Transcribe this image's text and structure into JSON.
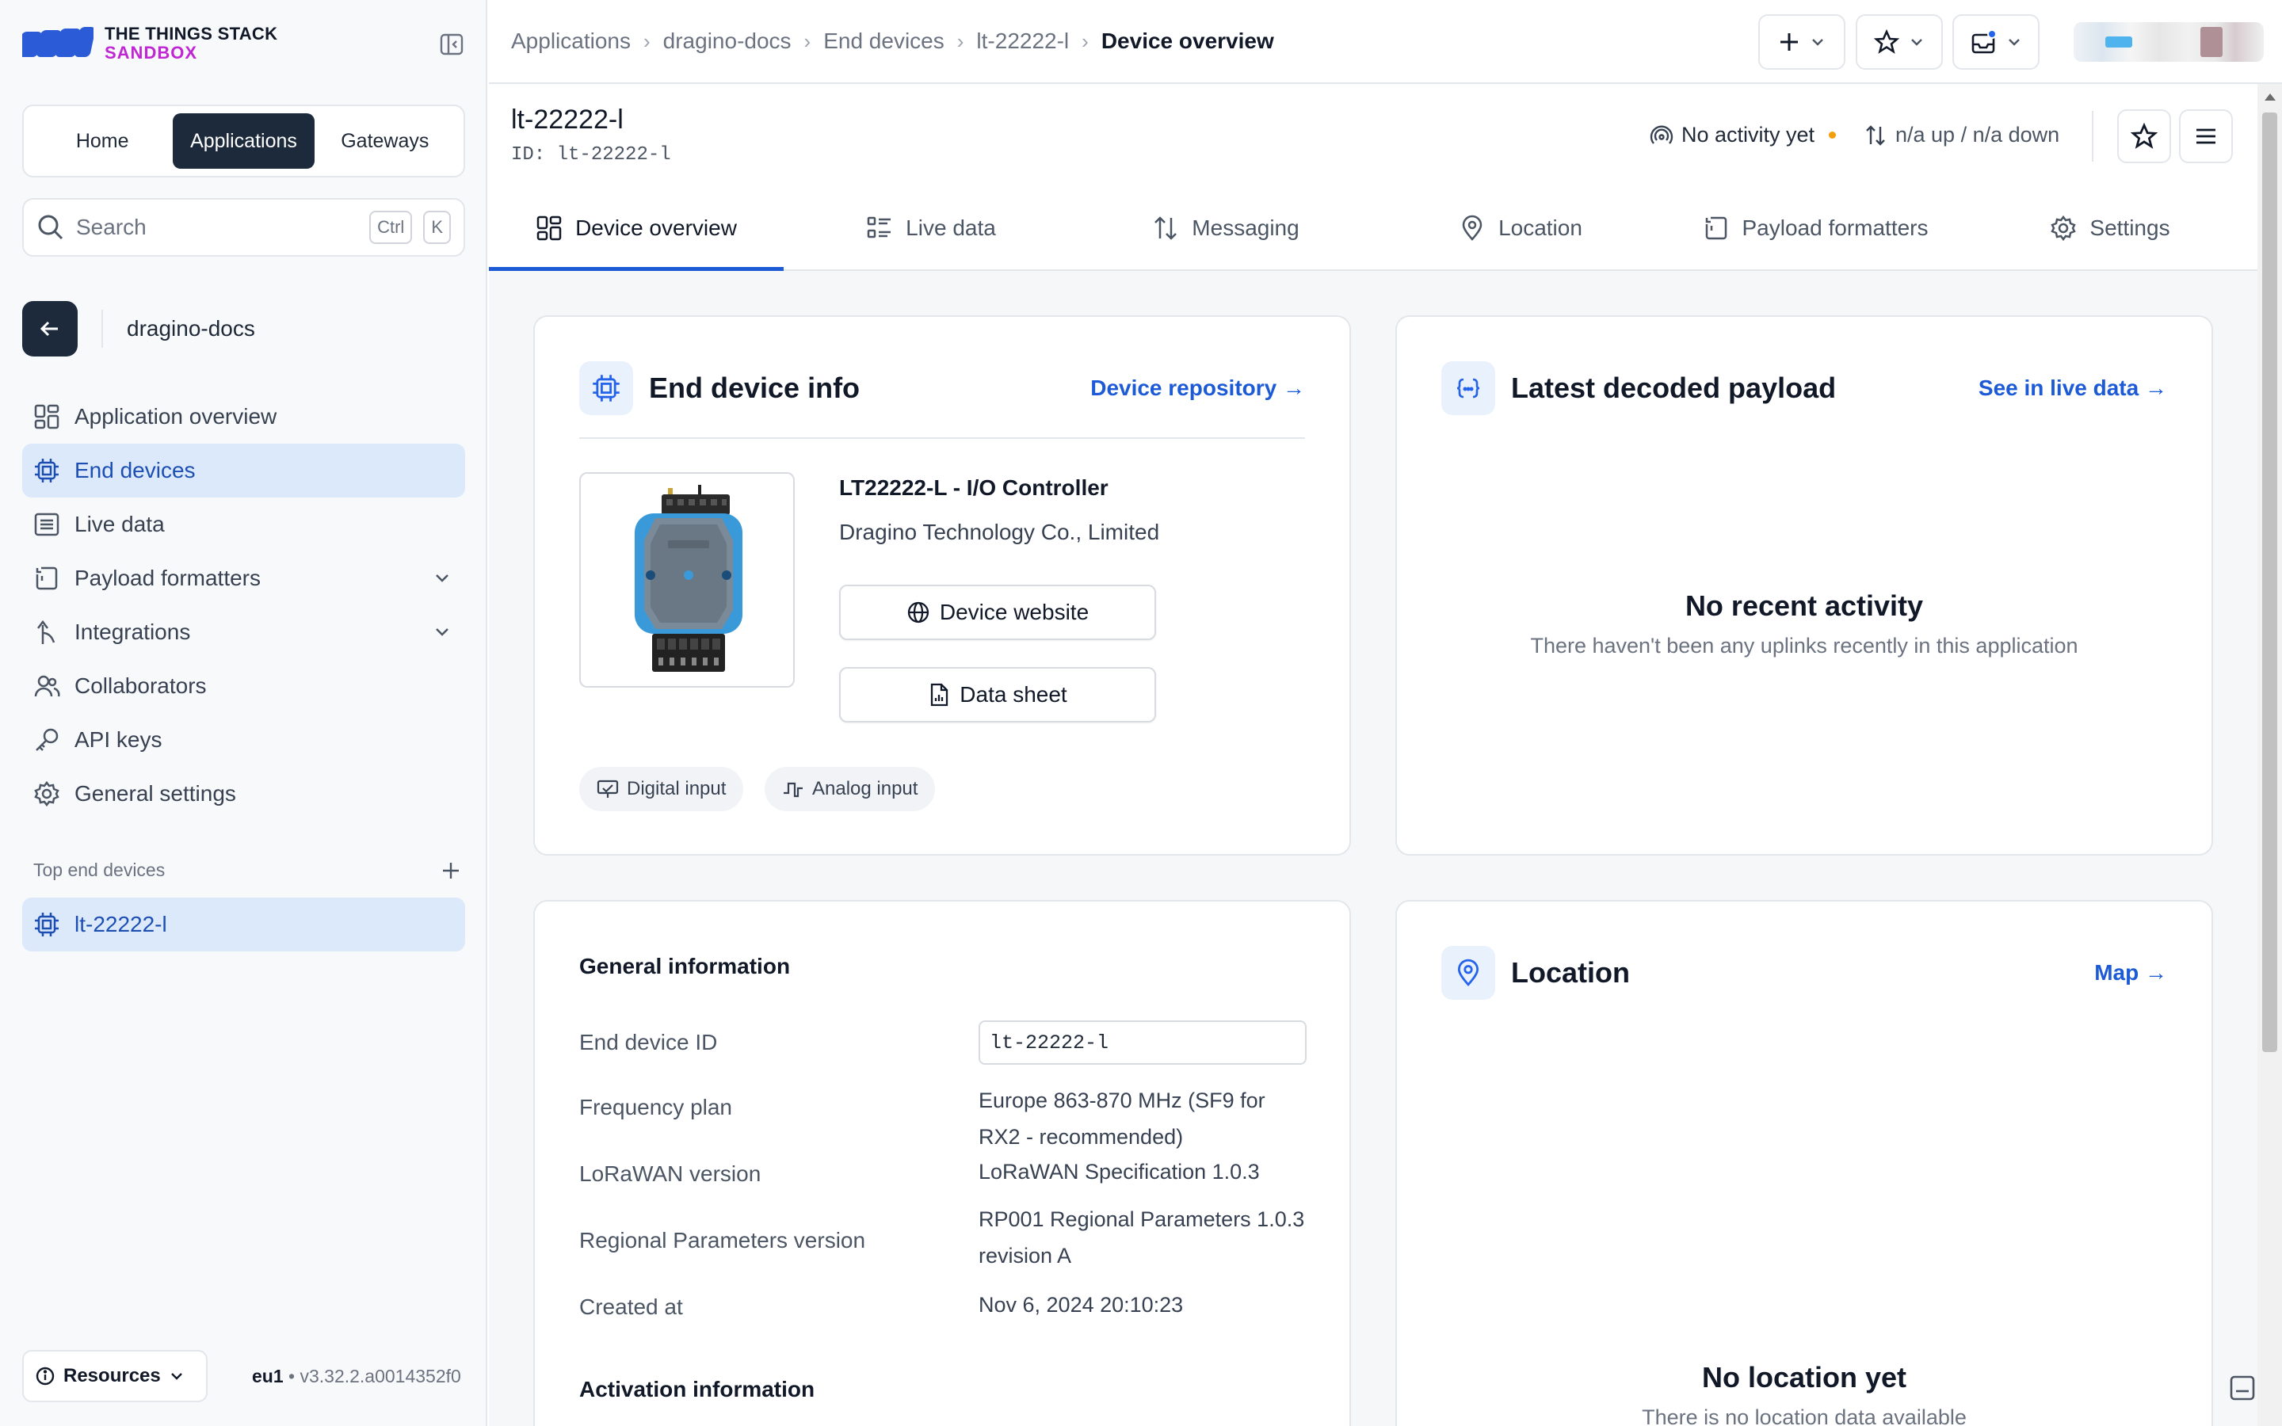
{
  "logo": {
    "line1": "THE THINGS STACK",
    "line2": "SANDBOX"
  },
  "switcher": {
    "home": "Home",
    "applications": "Applications",
    "gateways": "Gateways"
  },
  "search": {
    "placeholder": "Search",
    "kbd1": "Ctrl",
    "kbd2": "K"
  },
  "app_context": {
    "name": "dragino-docs"
  },
  "nav": [
    {
      "label": "Application overview",
      "icon": "grid-icon"
    },
    {
      "label": "End devices",
      "icon": "chip-icon",
      "active": true
    },
    {
      "label": "Live data",
      "icon": "list-icon"
    },
    {
      "label": "Payload formatters",
      "icon": "code-icon",
      "expandable": true
    },
    {
      "label": "Integrations",
      "icon": "integrations-icon",
      "expandable": true
    },
    {
      "label": "Collaborators",
      "icon": "users-icon"
    },
    {
      "label": "API keys",
      "icon": "key-icon"
    },
    {
      "label": "General settings",
      "icon": "gear-icon"
    }
  ],
  "top_devices": {
    "heading": "Top end devices",
    "items": [
      "lt-22222-l"
    ]
  },
  "footer": {
    "resources": "Resources",
    "region": "eu1",
    "version": " • v3.32.2.a0014352f0"
  },
  "breadcrumbs": [
    "Applications",
    "dragino-docs",
    "End devices",
    "lt-22222-l",
    "Device overview"
  ],
  "device": {
    "title": "lt-22222-l",
    "id_label": "ID:",
    "id": "lt-22222-l",
    "activity": "No activity yet",
    "traffic": "n/a up / n/a down"
  },
  "tabs": [
    "Device overview",
    "Live data",
    "Messaging",
    "Location",
    "Payload formatters",
    "Settings"
  ],
  "end_device_info": {
    "title": "End device info",
    "link": "Device repository →",
    "model": "LT22222-L - I/O Controller",
    "vendor": "Dragino Technology Co., Limited",
    "website_btn": "Device website",
    "datasheet_btn": "Data sheet",
    "tags": [
      "Digital input",
      "Analog input"
    ]
  },
  "latest_payload": {
    "title": "Latest decoded payload",
    "link": "See in live data →",
    "empty_title": "No recent activity",
    "empty_sub": "There haven't been any uplinks recently in this application"
  },
  "general_info": {
    "title": "General information",
    "rows": [
      {
        "label": "End device ID",
        "value": "lt-22222-l"
      },
      {
        "label": "Frequency plan",
        "value": "Europe 863-870 MHz (SF9 for RX2 - recommended)"
      },
      {
        "label": "LoRaWAN version",
        "value": "LoRaWAN Specification 1.0.3"
      },
      {
        "label": "Regional Parameters version",
        "value": "RP001 Regional Parameters 1.0.3 revision A"
      },
      {
        "label": "Created at",
        "value": "Nov 6, 2024 20:10:23"
      }
    ],
    "activation_title": "Activation information"
  },
  "location": {
    "title": "Location",
    "link": "Map →",
    "empty_title": "No location yet",
    "empty_sub": "There is no location data available"
  },
  "colors": {
    "accent": "#1d5ad6",
    "dark": "#1c2a3b",
    "active_bg": "#dbe9fb",
    "brand_magenta": "#c026d3"
  }
}
